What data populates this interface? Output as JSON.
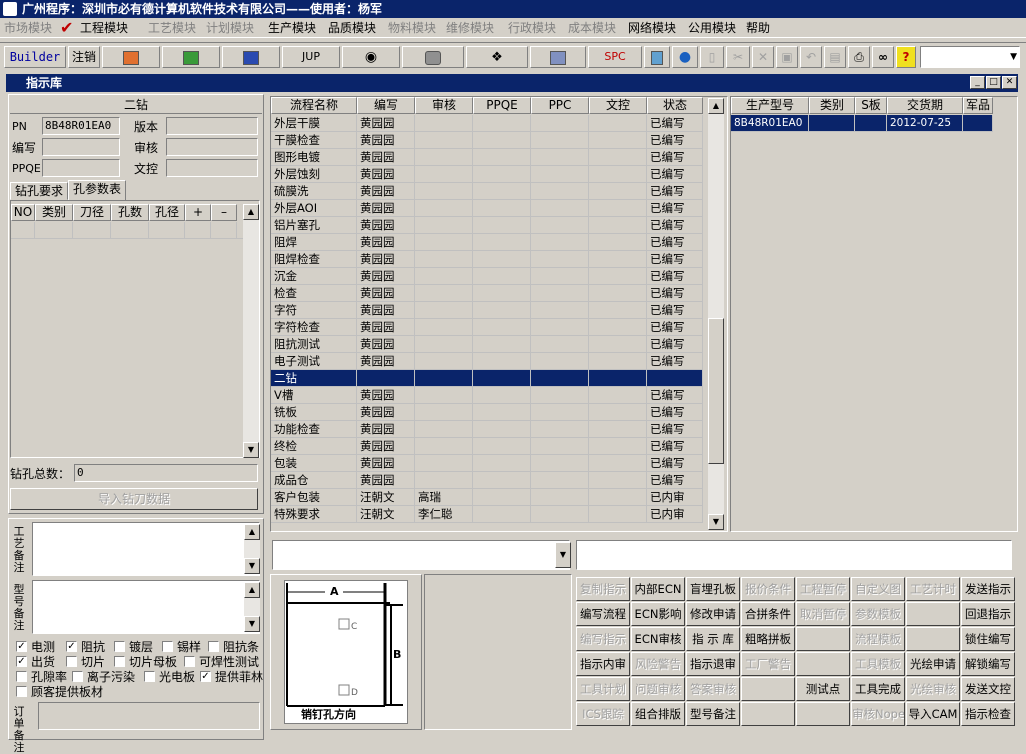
{
  "app_title": "广州程序：深圳市必有德计算机软件技术有限公司——使用者：杨军",
  "menus": [
    {
      "label": "市场模块",
      "disabled": true
    },
    {
      "label": "工程模块",
      "disabled": false
    },
    {
      "label": "工艺模块",
      "disabled": true
    },
    {
      "label": "计划模块",
      "disabled": true
    },
    {
      "label": "生产模块",
      "disabled": false
    },
    {
      "label": "品质模块",
      "disabled": false
    },
    {
      "label": "物料模块",
      "disabled": true
    },
    {
      "label": "维修模块",
      "disabled": true
    },
    {
      "label": "行政模块",
      "disabled": true
    },
    {
      "label": "成本模块",
      "disabled": true
    },
    {
      "label": "网络模块",
      "disabled": false
    },
    {
      "label": "公用模块",
      "disabled": false
    },
    {
      "label": "帮助",
      "disabled": false
    }
  ],
  "toolbar": {
    "builder": "Builder",
    "logout": "注销",
    "jup": "JUP",
    "spc": "SPC",
    "icons": [
      "powerpoint-icon",
      "excel-icon",
      "word-icon",
      "eye-icon",
      "database-icon",
      "network-icon",
      "printer-device-icon",
      "calculator-icon",
      "globe-icon",
      "new-doc-icon",
      "cut-icon",
      "delete-icon",
      "save-icon",
      "undo-icon",
      "preview-icon",
      "print-icon",
      "find-icon",
      "help-icon"
    ]
  },
  "window_title": "指示库",
  "left": {
    "process_name": "二钻",
    "pn_label": "PN",
    "pn_value": "8B48R01EA0",
    "version_label": "版本",
    "version_value": "",
    "author_label": "编写",
    "author_value": "",
    "review_label": "审核",
    "review_value": "",
    "ppqe_label": "PPQE",
    "ppqe_value": "",
    "docctrl_label": "文控",
    "docctrl_value": "",
    "tabs": [
      "钻孔要求",
      "孔参数表"
    ],
    "hole_columns": [
      "NO",
      "类别",
      "刀径",
      "孔数",
      "孔径",
      "+",
      "–"
    ],
    "total_label": "钻孔总数：",
    "total_value": "0",
    "import_button": "导入钻刀数据",
    "process_note_label": "工艺备注",
    "model_note_label": "型号备注",
    "order_note_label": "订单备注",
    "checkboxes": [
      {
        "label": "电测",
        "checked": true
      },
      {
        "label": "阻抗",
        "checked": true
      },
      {
        "label": "镀层",
        "checked": false
      },
      {
        "label": "锡样",
        "checked": false
      },
      {
        "label": "阻抗条",
        "checked": false
      },
      {
        "label": "出货",
        "checked": true
      },
      {
        "label": "切片",
        "checked": false
      },
      {
        "label": "切片母板",
        "checked": false
      },
      {
        "label": "可焊性测试",
        "checked": false
      },
      {
        "label": "孔隙率",
        "checked": false
      },
      {
        "label": "离子污染",
        "checked": false
      },
      {
        "label": "光电板",
        "checked": false
      },
      {
        "label": "提供菲林",
        "checked": true
      },
      {
        "label": "顾客提供板材",
        "checked": false
      }
    ]
  },
  "process_table": {
    "columns": [
      "流程名称",
      "编写",
      "审核",
      "PPQE",
      "PPC",
      "文控",
      "状态"
    ],
    "rows": [
      [
        "外层干膜",
        "黄园园",
        "",
        "",
        "",
        "",
        "已编写"
      ],
      [
        "干膜检查",
        "黄园园",
        "",
        "",
        "",
        "",
        "已编写"
      ],
      [
        "图形电镀",
        "黄园园",
        "",
        "",
        "",
        "",
        "已编写"
      ],
      [
        "外层蚀刻",
        "黄园园",
        "",
        "",
        "",
        "",
        "已编写"
      ],
      [
        "硫膜洗",
        "黄园园",
        "",
        "",
        "",
        "",
        "已编写"
      ],
      [
        "外层AOI",
        "黄园园",
        "",
        "",
        "",
        "",
        "已编写"
      ],
      [
        "铝片塞孔",
        "黄园园",
        "",
        "",
        "",
        "",
        "已编写"
      ],
      [
        "阻焊",
        "黄园园",
        "",
        "",
        "",
        "",
        "已编写"
      ],
      [
        "阻焊检查",
        "黄园园",
        "",
        "",
        "",
        "",
        "已编写"
      ],
      [
        "沉金",
        "黄园园",
        "",
        "",
        "",
        "",
        "已编写"
      ],
      [
        "检查",
        "黄园园",
        "",
        "",
        "",
        "",
        "已编写"
      ],
      [
        "字符",
        "黄园园",
        "",
        "",
        "",
        "",
        "已编写"
      ],
      [
        "字符检查",
        "黄园园",
        "",
        "",
        "",
        "",
        "已编写"
      ],
      [
        "阻抗测试",
        "黄园园",
        "",
        "",
        "",
        "",
        "已编写"
      ],
      [
        "电子测试",
        "黄园园",
        "",
        "",
        "",
        "",
        "已编写"
      ],
      [
        "二钻",
        "",
        "",
        "",
        "",
        "",
        ""
      ],
      [
        "V槽",
        "黄园园",
        "",
        "",
        "",
        "",
        "已编写"
      ],
      [
        "铣板",
        "黄园园",
        "",
        "",
        "",
        "",
        "已编写"
      ],
      [
        "功能检查",
        "黄园园",
        "",
        "",
        "",
        "",
        "已编写"
      ],
      [
        "终检",
        "黄园园",
        "",
        "",
        "",
        "",
        "已编写"
      ],
      [
        "包装",
        "黄园园",
        "",
        "",
        "",
        "",
        "已编写"
      ],
      [
        "成品仓",
        "黄园园",
        "",
        "",
        "",
        "",
        "已编写"
      ],
      [
        "客户包装",
        "汪朝文",
        "高瑞",
        "",
        "",
        "",
        "已内审"
      ],
      [
        "特殊要求",
        "汪朝文",
        "李仁聪",
        "",
        "",
        "",
        "已内审"
      ]
    ],
    "selected_index": 15
  },
  "order_table": {
    "columns": [
      "生产型号",
      "类别",
      "S板",
      "交货期",
      "军品"
    ],
    "rows": [
      [
        "8B48R01EA0",
        "",
        "",
        "2012-07-25",
        ""
      ]
    ]
  },
  "diagram": {
    "label_a": "A",
    "label_b": "B",
    "label_c": "C",
    "label_d": "D",
    "caption": "销钉孔方向"
  },
  "action_buttons": [
    [
      {
        "label": "复制指示",
        "disabled": true
      },
      {
        "label": "内部ECN",
        "disabled": false
      },
      {
        "label": "盲埋孔板",
        "disabled": false
      },
      {
        "label": "报价条件",
        "disabled": true
      },
      {
        "label": "工程暂停",
        "disabled": true
      },
      {
        "label": "自定义图",
        "disabled": true
      },
      {
        "label": "工艺计时",
        "disabled": true
      },
      {
        "label": "发送指示",
        "disabled": false
      }
    ],
    [
      {
        "label": "编写流程",
        "disabled": false
      },
      {
        "label": "ECN影响",
        "disabled": false
      },
      {
        "label": "修改申请",
        "disabled": false
      },
      {
        "label": "合拼条件",
        "disabled": false
      },
      {
        "label": "取消暂停",
        "disabled": true
      },
      {
        "label": "参数模板",
        "disabled": true
      },
      {
        "label": "",
        "disabled": true
      },
      {
        "label": "回退指示",
        "disabled": false
      }
    ],
    [
      {
        "label": "编写指示",
        "disabled": true
      },
      {
        "label": "ECN审核",
        "disabled": false
      },
      {
        "label": "指 示 库",
        "disabled": false
      },
      {
        "label": "粗略拼板",
        "disabled": false
      },
      {
        "label": "",
        "disabled": true
      },
      {
        "label": "流程模板",
        "disabled": true
      },
      {
        "label": "",
        "disabled": true
      },
      {
        "label": "锁住编写",
        "disabled": false
      }
    ],
    [
      {
        "label": "指示内审",
        "disabled": false
      },
      {
        "label": "风险警告",
        "disabled": true
      },
      {
        "label": "指示退审",
        "disabled": false
      },
      {
        "label": "工厂警告",
        "disabled": true
      },
      {
        "label": "",
        "disabled": true
      },
      {
        "label": "工具模板",
        "disabled": true
      },
      {
        "label": "光绘申请",
        "disabled": false
      },
      {
        "label": "解锁编写",
        "disabled": false
      }
    ],
    [
      {
        "label": "工具计划",
        "disabled": true
      },
      {
        "label": "问题审核",
        "disabled": true
      },
      {
        "label": "答案审核",
        "disabled": true
      },
      {
        "label": "",
        "disabled": true
      },
      {
        "label": "测试点",
        "disabled": false
      },
      {
        "label": "工具完成",
        "disabled": false
      },
      {
        "label": "光绘审核",
        "disabled": true
      },
      {
        "label": "发送文控",
        "disabled": false
      }
    ],
    [
      {
        "label": "ICS跟踪",
        "disabled": true
      },
      {
        "label": "组合排版",
        "disabled": false
      },
      {
        "label": "型号备注",
        "disabled": false
      },
      {
        "label": "",
        "disabled": true
      },
      {
        "label": "",
        "disabled": true
      },
      {
        "label": "审核Nope",
        "disabled": true
      },
      {
        "label": "导入CAM",
        "disabled": false
      },
      {
        "label": "指示检查",
        "disabled": false
      }
    ]
  ]
}
